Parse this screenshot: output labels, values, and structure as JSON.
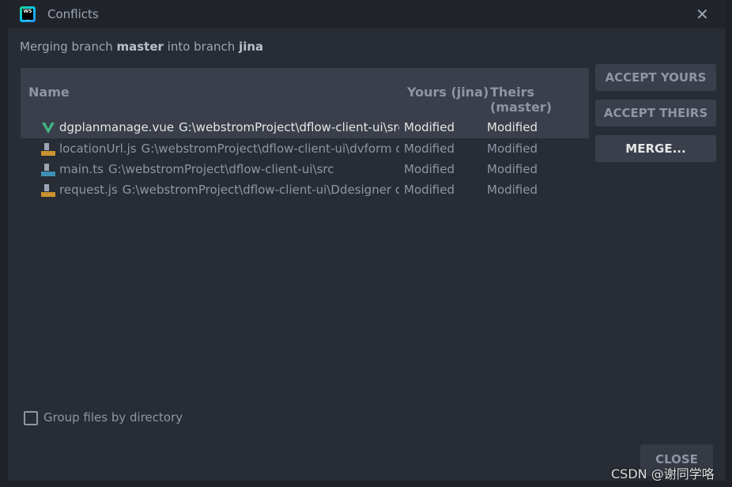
{
  "window": {
    "title": "Conflicts",
    "close_icon": "close-icon"
  },
  "subtitle": {
    "prefix": "Merging branch ",
    "source": "master",
    "middle": " into branch ",
    "target": "jina"
  },
  "table": {
    "headers": [
      "Name",
      "Yours (jina)",
      "Theirs (master)"
    ],
    "rows": [
      {
        "name": "dgplanmanage.vue",
        "path": "G:\\webstromProject\\dflow-client-ui\\src",
        "yours": "Modified",
        "theirs": "Modified",
        "icon": "vue-file-icon",
        "selected": true
      },
      {
        "name": "locationUrl.js",
        "path": "G:\\webstromProject\\dflow-client-ui\\dvform  c",
        "yours": "Modified",
        "theirs": "Modified",
        "icon": "js-file-icon"
      },
      {
        "name": "main.ts",
        "path": "G:\\webstromProject\\dflow-client-ui\\src",
        "yours": "Modified",
        "theirs": "Modified",
        "icon": "ts-file-icon"
      },
      {
        "name": "request.js",
        "path": "G:\\webstromProject\\dflow-client-ui\\Ddesigner  c",
        "yours": "Modified",
        "theirs": "Modified",
        "icon": "js-file-icon"
      }
    ]
  },
  "buttons": {
    "accept_yours": "ACCEPT YOURS",
    "accept_theirs": "ACCEPT THEIRS",
    "merge": "MERGE...",
    "close": "CLOSE"
  },
  "group_by_directory": {
    "label": "Group files by directory",
    "checked": false
  },
  "watermark": "CSDN @谢同学咯"
}
